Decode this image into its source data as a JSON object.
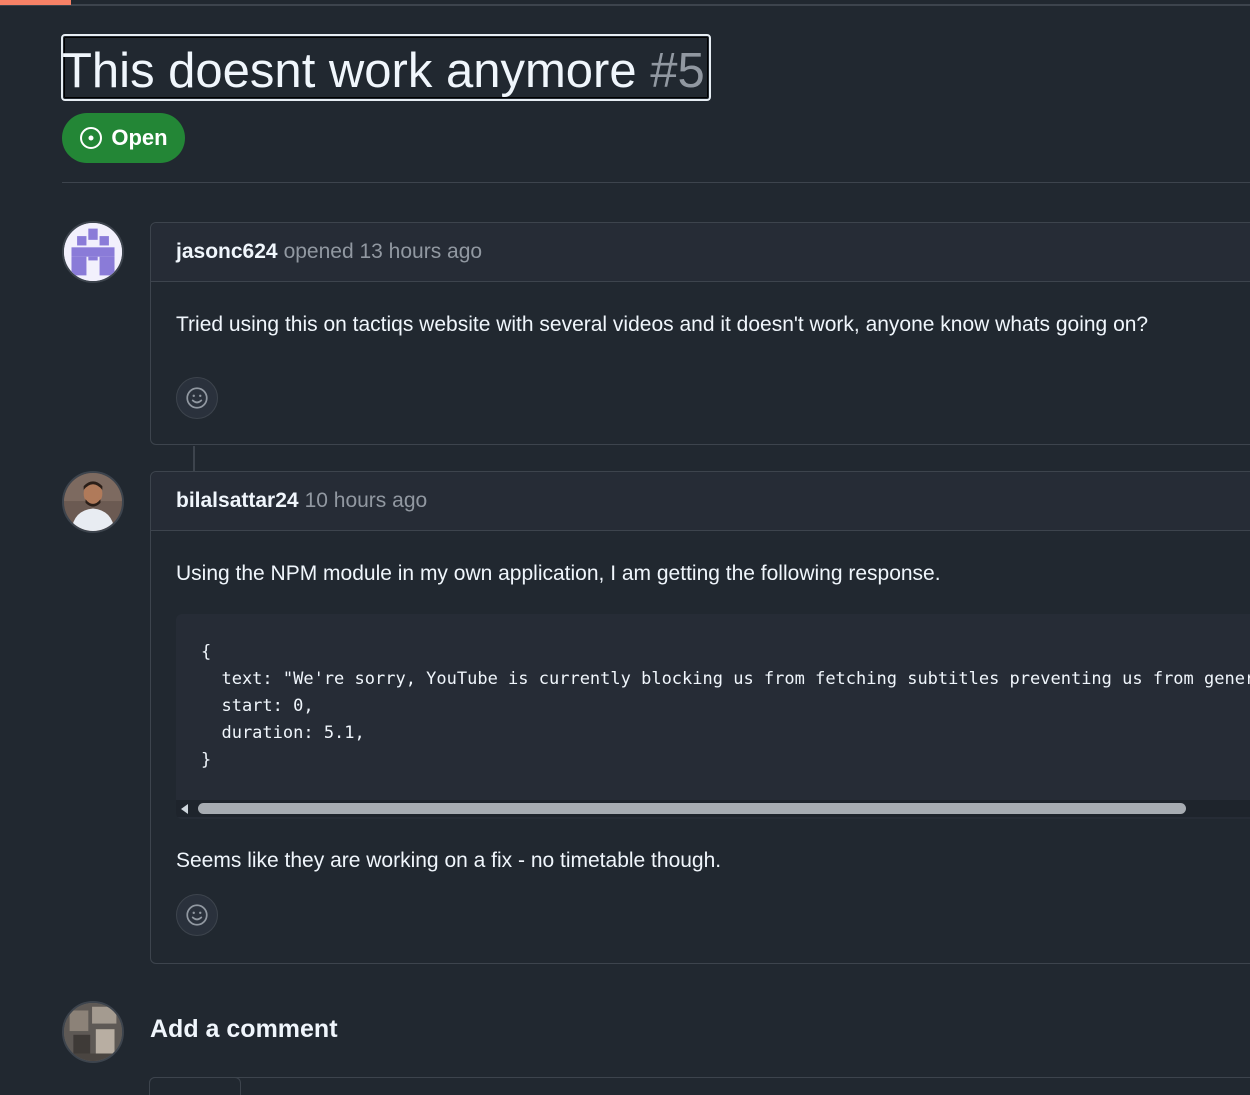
{
  "issue": {
    "title": "This doesnt work anymore",
    "number": "#5",
    "state": "Open"
  },
  "comments": [
    {
      "author": "jasonc624",
      "meta": "opened 13 hours ago",
      "body": "Tried using this on tactiqs website with several videos and it doesn't work, anyone know whats going on?"
    },
    {
      "author": "bilalsattar24",
      "meta": "10 hours ago",
      "intro": "Using the NPM module in my own application, I am getting the following response.",
      "code": [
        "{",
        "  text: \"We're sorry, YouTube is currently blocking us from fetching subtitles preventing us from gener",
        "  start: 0,",
        "  duration: 5.1,",
        "}"
      ],
      "outro": "Seems like they are working on a fix - no timetable though."
    }
  ],
  "add_comment": {
    "title": "Add a comment"
  },
  "icons": {
    "state": "issue-opened-icon",
    "reaction": "smiley-icon"
  },
  "colors": {
    "open_badge": "#238636",
    "accent_progress": "#f78166",
    "background": "#212830"
  }
}
